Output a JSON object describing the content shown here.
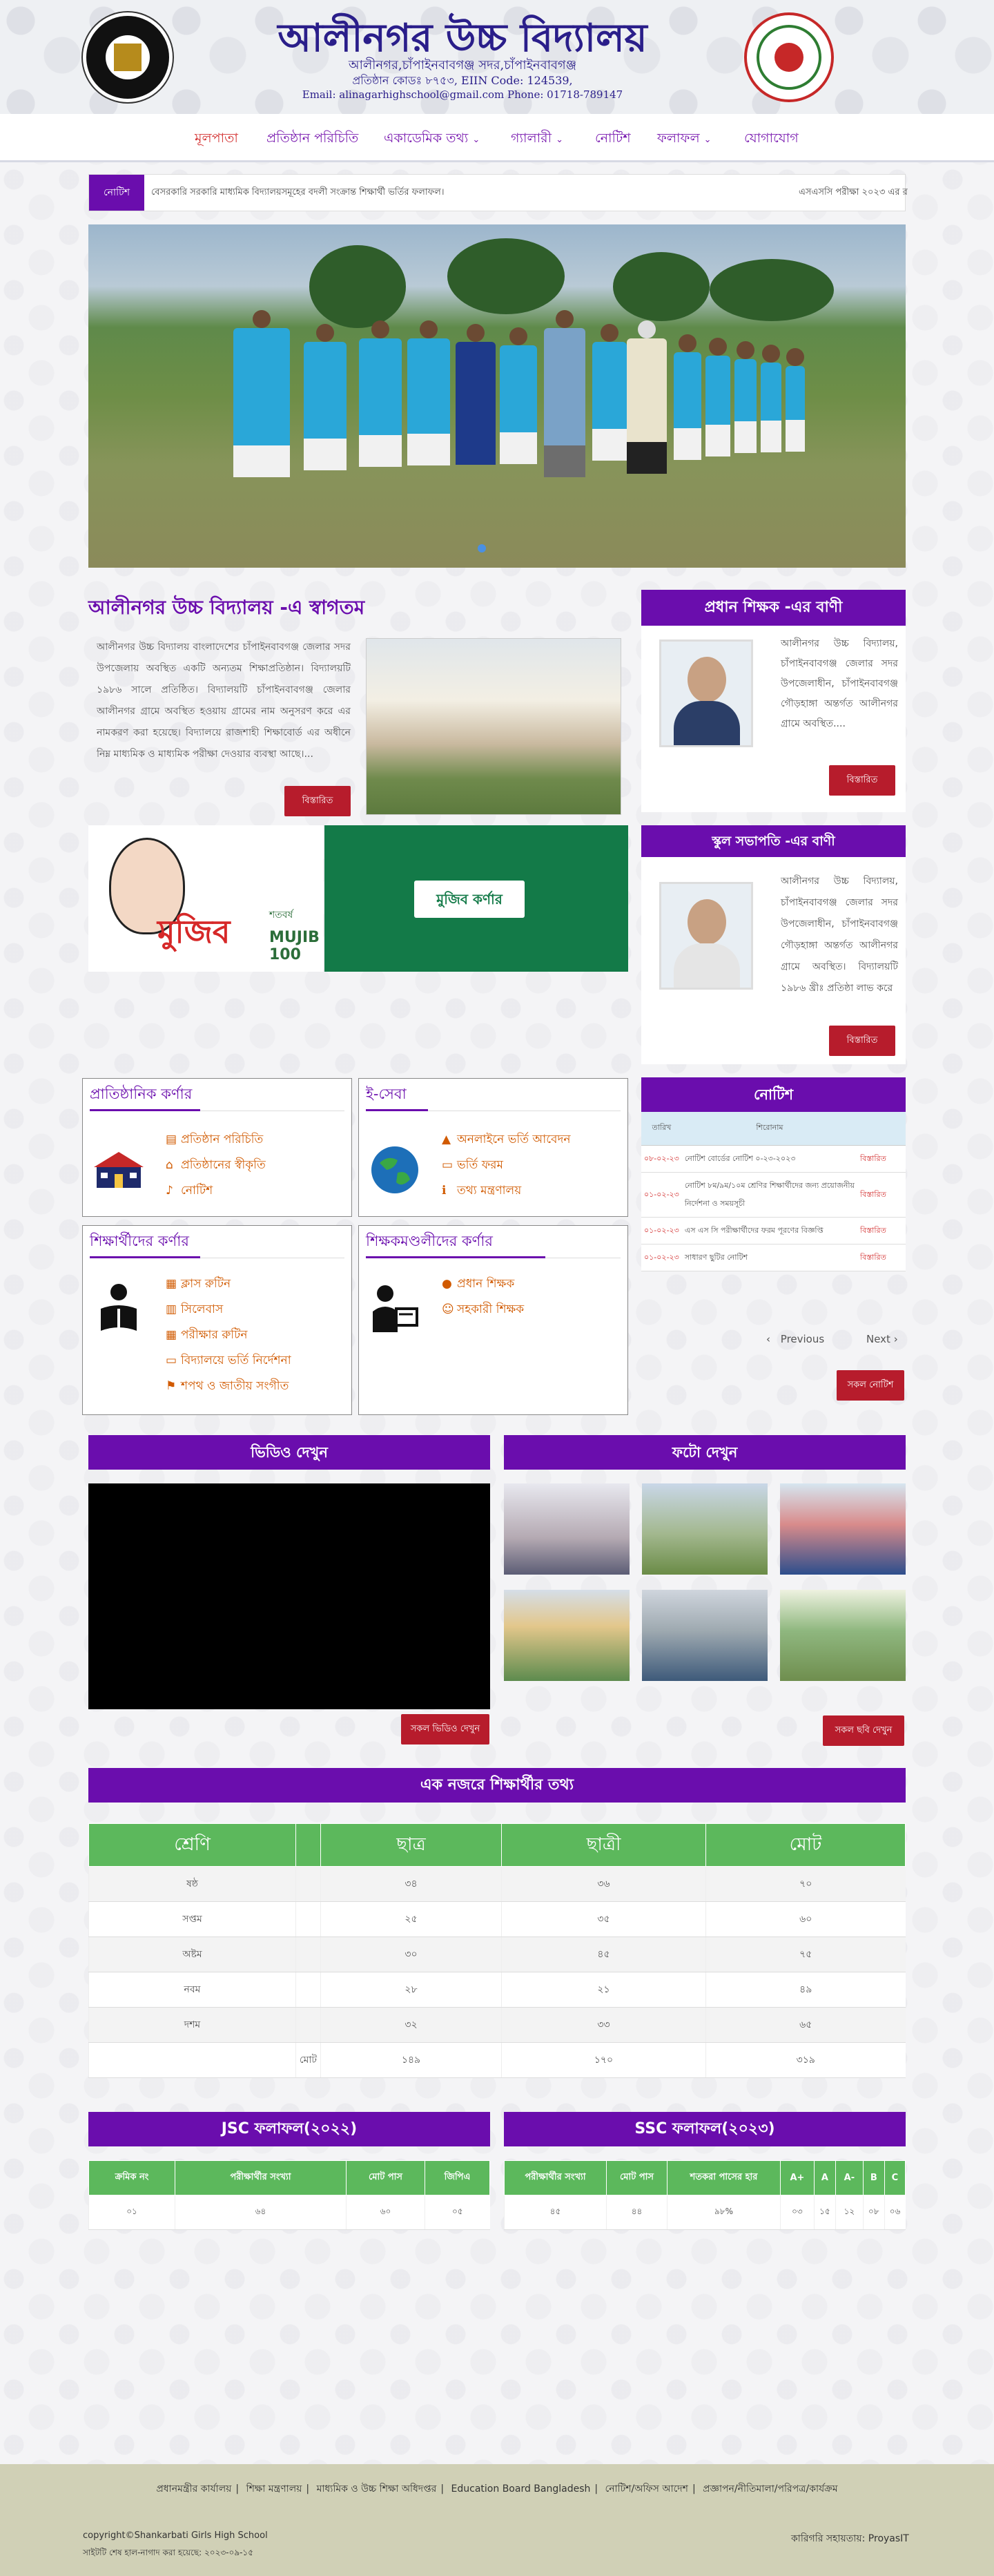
{
  "header": {
    "title": "আলীনগর উচ্চ বিদ্যালয়",
    "address": "আলীনগর,চাঁপাইনবাবগঞ্জ সদর,চাঁপাইনবাবগঞ্জ",
    "code": "প্রতিষ্ঠান কোডঃ ৮৭৫৩, EIIN Code: 124539,",
    "contact": "Email: alinagarhighschool@gmail.com Phone: 01718-789147"
  },
  "nav": {
    "items": [
      {
        "label": "মূলপাতা"
      },
      {
        "label": "প্রতিষ্ঠান পরিচিতি"
      },
      {
        "label": "একাডেমিক তথ্য"
      },
      {
        "label": "গ্যালারী"
      },
      {
        "label": "নোটিশ"
      },
      {
        "label": "ফলাফল"
      },
      {
        "label": "যোগাযোগ"
      }
    ]
  },
  "ticker": {
    "label": "নোটিশ",
    "text": "বেসরকারি সরকারি মাধ্যমিক বিদ্যালয়সমূহের বদলী সংক্রান্ত শিক্ষার্থী ভর্তির ফলাফল।",
    "text2": "এসএসসি পরীক্ষা ২০২৩ এর র"
  },
  "welcome": {
    "title": "আলীনগর উচ্চ বিদ্যালয় -এ স্বাগতম",
    "text": "আলীনগর উচ্চ বিদ্যালয় বাংলাদেশের চাঁপাইনবাবগঞ্জ জেলার সদর উপজেলায় অবস্থিত একটি অন্যতম শিক্ষাপ্রতিষ্ঠান। বিদ্যালয়টি ১৯৮৬ সালে প্রতিষ্ঠিত। বিদ্যালয়টি চাঁপাইনবাবগঞ্জ জেলার আলীনগর গ্রামে অবস্থিত হওয়ায় গ্রামের নাম অনুসরণ করে এর নামকরণ করা হয়েছে। বিদ্যালয়ে রাজশাহী শিক্ষাবোর্ড এর অধীনে নিম্ন মাধ্যমিক ও মাধ্যমিক পরীক্ষা দেওয়ার ব্যবস্থা আছে।...",
    "more": "বিস্তারিত"
  },
  "mujib": {
    "word": "মুজিব",
    "sub": "শতবর্ষ",
    "hundred": "MUJIB 100",
    "button": "মুজিব কর্ণার"
  },
  "head_message": {
    "title": "প্রধান শিক্ষক -এর বাণী",
    "text": "আলীনগর উচ্চ বিদ্যালয়, চাঁপাইনবাবগঞ্জ জেলার সদর উপজেলাধীন, চাঁপাইনবাবগঞ্জ গৌড়হাঙ্গা অন্তর্গত আলীনগর গ্রামে অবস্থিত....",
    "more": "বিস্তারিত"
  },
  "president_message": {
    "title": "স্কুল সভাপতি -এর বাণী",
    "text": "আলীনগর উচ্চ বিদ্যালয়, চাঁপাইনবাবগঞ্জ জেলার সদর উপজেলাধীন, চাঁপাইনবাবগঞ্জ গৌড়হাঙ্গা অন্তর্গত আলীনগর গ্রামে অবস্থিত। বিদ্যালয়টি ১৯৮৬ খ্রীঃ প্রতিষ্ঠা লাভ করে",
    "more": "বিস্তারিত"
  },
  "corners": {
    "institution": {
      "title": "প্রাতিষ্ঠানিক কর্ণার",
      "links": [
        "প্রতিষ্ঠান পরিচিতি",
        "প্রতিষ্ঠানের স্বীকৃতি",
        "নোটিশ"
      ]
    },
    "eservice": {
      "title": "ই-সেবা",
      "links": [
        "অনলাইনে ভর্তি আবেদন",
        "ভর্তি ফরম",
        "তথ্য মন্ত্রণালয়"
      ]
    },
    "students": {
      "title": "শিক্ষার্থীদের কর্ণার",
      "links": [
        "ক্লাস রুটিন",
        "সিলেবাস",
        "পরীক্ষার রুটিন",
        "বিদ্যালয়ে ভর্তি নির্দেশনা",
        "শপথ ও জাতীয় সংগীত"
      ]
    },
    "teachers": {
      "title": "শিক্ষকমণ্ডলীদের কর্ণার",
      "links": [
        "প্রধান শিক্ষক",
        "সহকারী শিক্ষক"
      ]
    }
  },
  "notice_board": {
    "title": "নোটিশ",
    "col_date": "তারিখ",
    "col_title": "শিরোনাম",
    "rows": [
      {
        "date": "০৮-০২-২৩",
        "title": "নোটিশ বোর্ডের নোটিশ ০-২৩-২০২৩",
        "view": "বিস্তারিত"
      },
      {
        "date": "০১-০২-২৩",
        "title": "নোটিশ ৮ম/৯ম/১০ম শ্রেণির শিক্ষার্থীদের জন্য প্রয়োজনীয় নির্দেশনা ও সময়সূচী",
        "view": "বিস্তারিত"
      },
      {
        "date": "০১-০২-২৩",
        "title": "এস এস সি পরীক্ষার্থীদের ফরম পূরণের বিজ্ঞপ্তি",
        "view": "বিস্তারিত"
      },
      {
        "date": "০১-০২-২৩",
        "title": "সাধারণ ছুটির নোটিশ",
        "view": "বিস্তারিত"
      }
    ],
    "prev": "Previous",
    "next": "Next",
    "all": "সকল নোটিশ"
  },
  "media": {
    "video_title": "ভিডিও দেখুন",
    "photo_title": "ফটো দেখুন",
    "video_more": "সকল ভিডিও দেখুন",
    "photo_more": "সকল ছবি দেখুন"
  },
  "students_info": {
    "title": "এক নজরে শিক্ষার্থীর তথ্য",
    "headers": [
      "শ্রেণি",
      "",
      "ছাত্র",
      "ছাত্রী",
      "মোট"
    ],
    "rows": [
      [
        "ষষ্ঠ",
        "",
        "৩৪",
        "৩৬",
        "৭০"
      ],
      [
        "সপ্তম",
        "",
        "২৫",
        "৩৫",
        "৬০"
      ],
      [
        "অষ্টম",
        "",
        "৩০",
        "৪৫",
        "৭৫"
      ],
      [
        "নবম",
        "",
        "২৮",
        "২১",
        "৪৯"
      ],
      [
        "দশম",
        "",
        "৩২",
        "৩৩",
        "৬৫"
      ],
      [
        "",
        "মোট",
        "১৪৯",
        "১৭০",
        "৩১৯"
      ]
    ]
  },
  "jsc": {
    "title": "JSC ফলাফল(২০২২)",
    "headers": [
      "ক্রমিক নং",
      "পরীক্ষার্থীর সংখ্যা",
      "মোট পাস",
      "জিপিএ"
    ],
    "row": [
      "০১",
      "৬৪",
      "৬০",
      "০৫"
    ]
  },
  "ssc": {
    "title": "SSC ফলাফল(২০২৩)",
    "headers": [
      "পরীক্ষার্থীর সংখ্যা",
      "মোট পাস",
      "শতকরা পাসের হার",
      "A+",
      "A",
      "A-",
      "B",
      "C"
    ],
    "row": [
      "৪৫",
      "৪৪",
      "৯৮%",
      "০৩",
      "১৫",
      "১২",
      "০৮",
      "০৬"
    ]
  },
  "footer": {
    "links": [
      "প্রধানমন্ত্রীর কার্যালয়",
      "শিক্ষা মন্ত্রণালয়",
      "মাধ্যমিক ও উচ্চ শিক্ষা অধিদপ্তর",
      "Education Board Bangladesh",
      "নোটিশ/অফিস আদেশ",
      "প্রজ্ঞাপন/নীতিমালা/পরিপত্র/কার্যক্রম"
    ],
    "copyright": "copyright©Shankarbati Girls High School",
    "updated": "সাইটটি শেষ হাল-নাগাদ করা হয়েছে: ২০২৩-০৯-১৫",
    "dev_label": "কারিগরি সহায়তায়:",
    "dev_name": "ProyasIT"
  },
  "colors": {
    "brand_purple": "#6a0dad",
    "table_green": "#5cb85c",
    "button_red": "#b71c2c",
    "title_blue": "#2a1e8a",
    "mujib_green": "#137a48",
    "footer_bg": "#d0d0b6"
  }
}
